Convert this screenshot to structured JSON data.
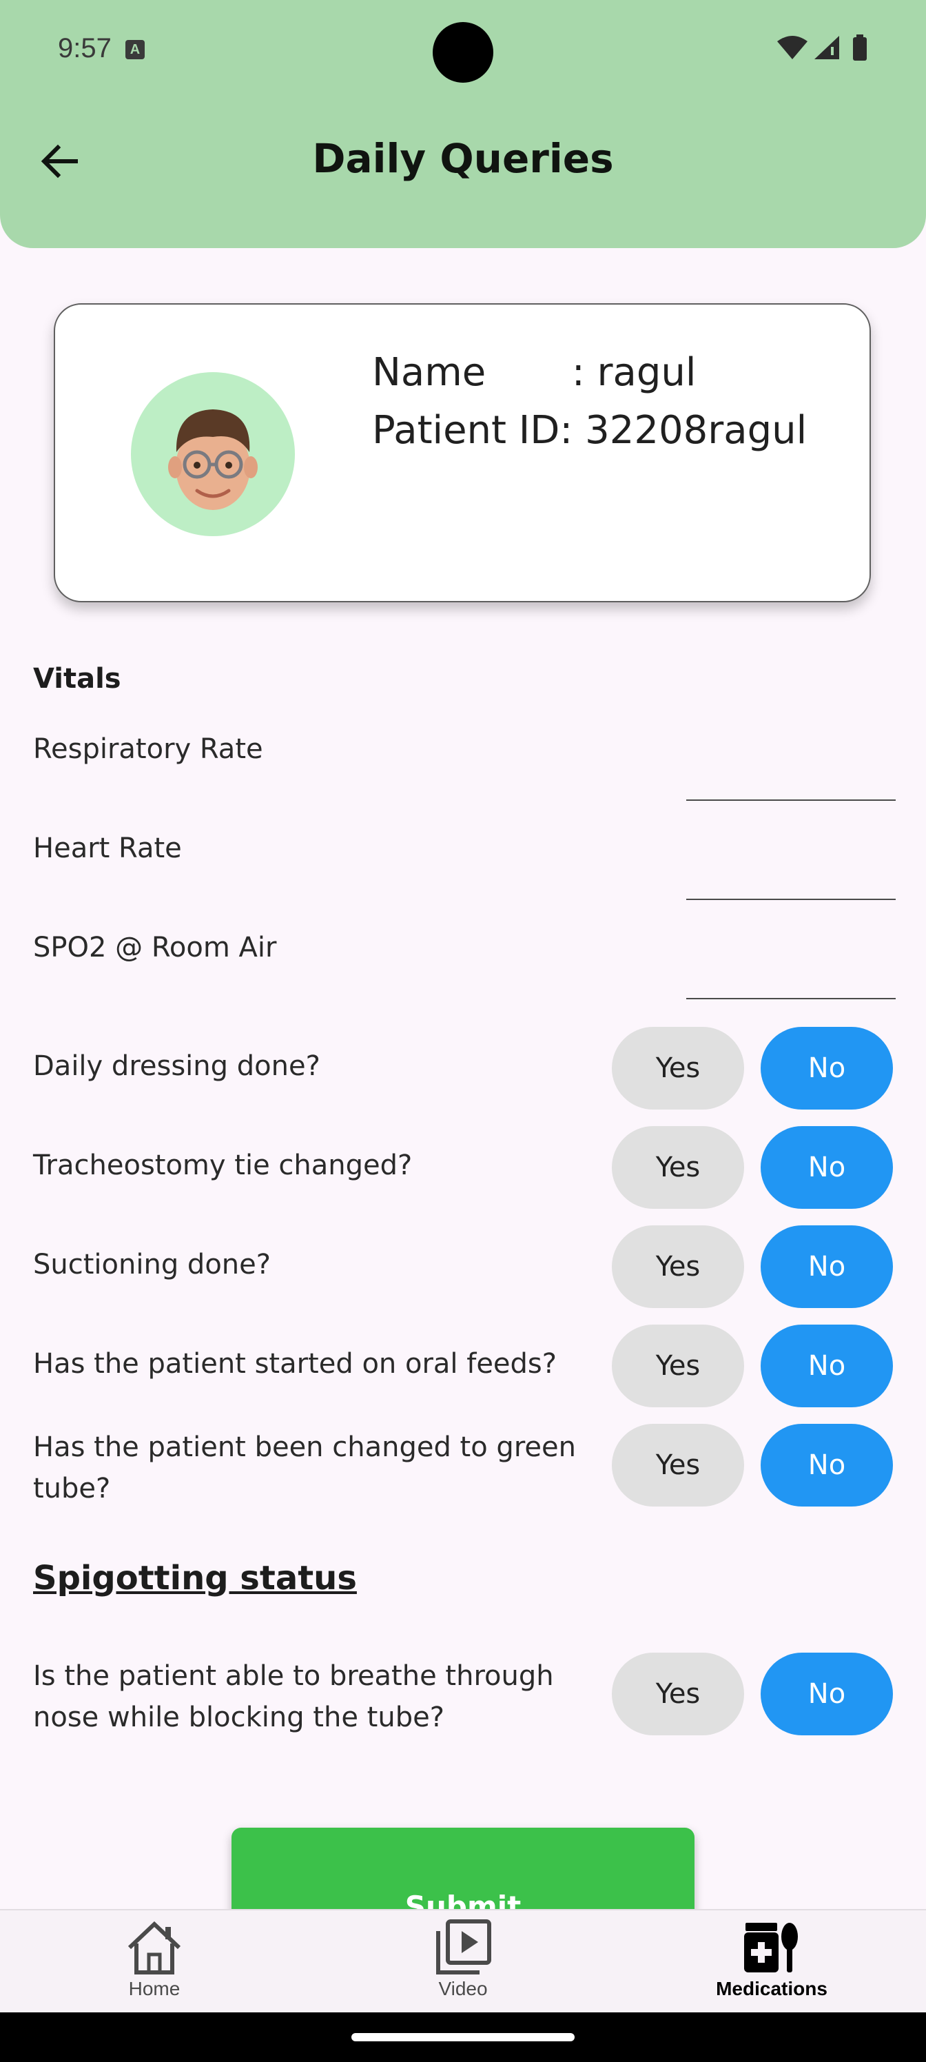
{
  "status_bar": {
    "time": "9:57",
    "notification_badge": "A"
  },
  "header": {
    "title": "Daily Queries",
    "back_icon": "arrow-left-icon"
  },
  "patient_card": {
    "avatar_icon": "memoji-avatar-icon",
    "name_line": "Name       : ragul",
    "id_line": "Patient ID: 32208ragul"
  },
  "vitals": {
    "section_title": "Vitals",
    "fields": [
      {
        "label": "Respiratory Rate",
        "value": ""
      },
      {
        "label": "Heart Rate",
        "value": ""
      },
      {
        "label": "SPO2 @ Room Air",
        "value": ""
      }
    ]
  },
  "questions": [
    {
      "label": "Daily dressing done?",
      "yes": "Yes",
      "no": "No",
      "selected": "No"
    },
    {
      "label": "Tracheostomy tie changed?",
      "yes": "Yes",
      "no": "No",
      "selected": "No"
    },
    {
      "label": "Suctioning done?",
      "yes": "Yes",
      "no": "No",
      "selected": "No"
    },
    {
      "label": "Has the patient started on oral feeds?",
      "yes": "Yes",
      "no": "No",
      "selected": "No"
    },
    {
      "label": "Has the patient been changed to green tube?",
      "yes": "Yes",
      "no": "No",
      "selected": "No"
    }
  ],
  "spigotting": {
    "title": "Spigotting status",
    "question": {
      "label": "Is the patient able to breathe through nose while blocking the tube?",
      "yes": "Yes",
      "no": "No",
      "selected": "No"
    }
  },
  "submit_label": "Submit",
  "bottom_nav": {
    "items": [
      {
        "label": "Home",
        "icon": "home-icon",
        "active": false
      },
      {
        "label": "Video",
        "icon": "video-library-icon",
        "active": false
      },
      {
        "label": "Medications",
        "icon": "medications-icon",
        "active": true
      }
    ]
  },
  "colors": {
    "header": "#a8d8ab",
    "no_selected": "#2196f3",
    "yes_default": "#e0e0e0",
    "submit": "#3cc14a",
    "avatar_bg": "#bdeec5"
  }
}
